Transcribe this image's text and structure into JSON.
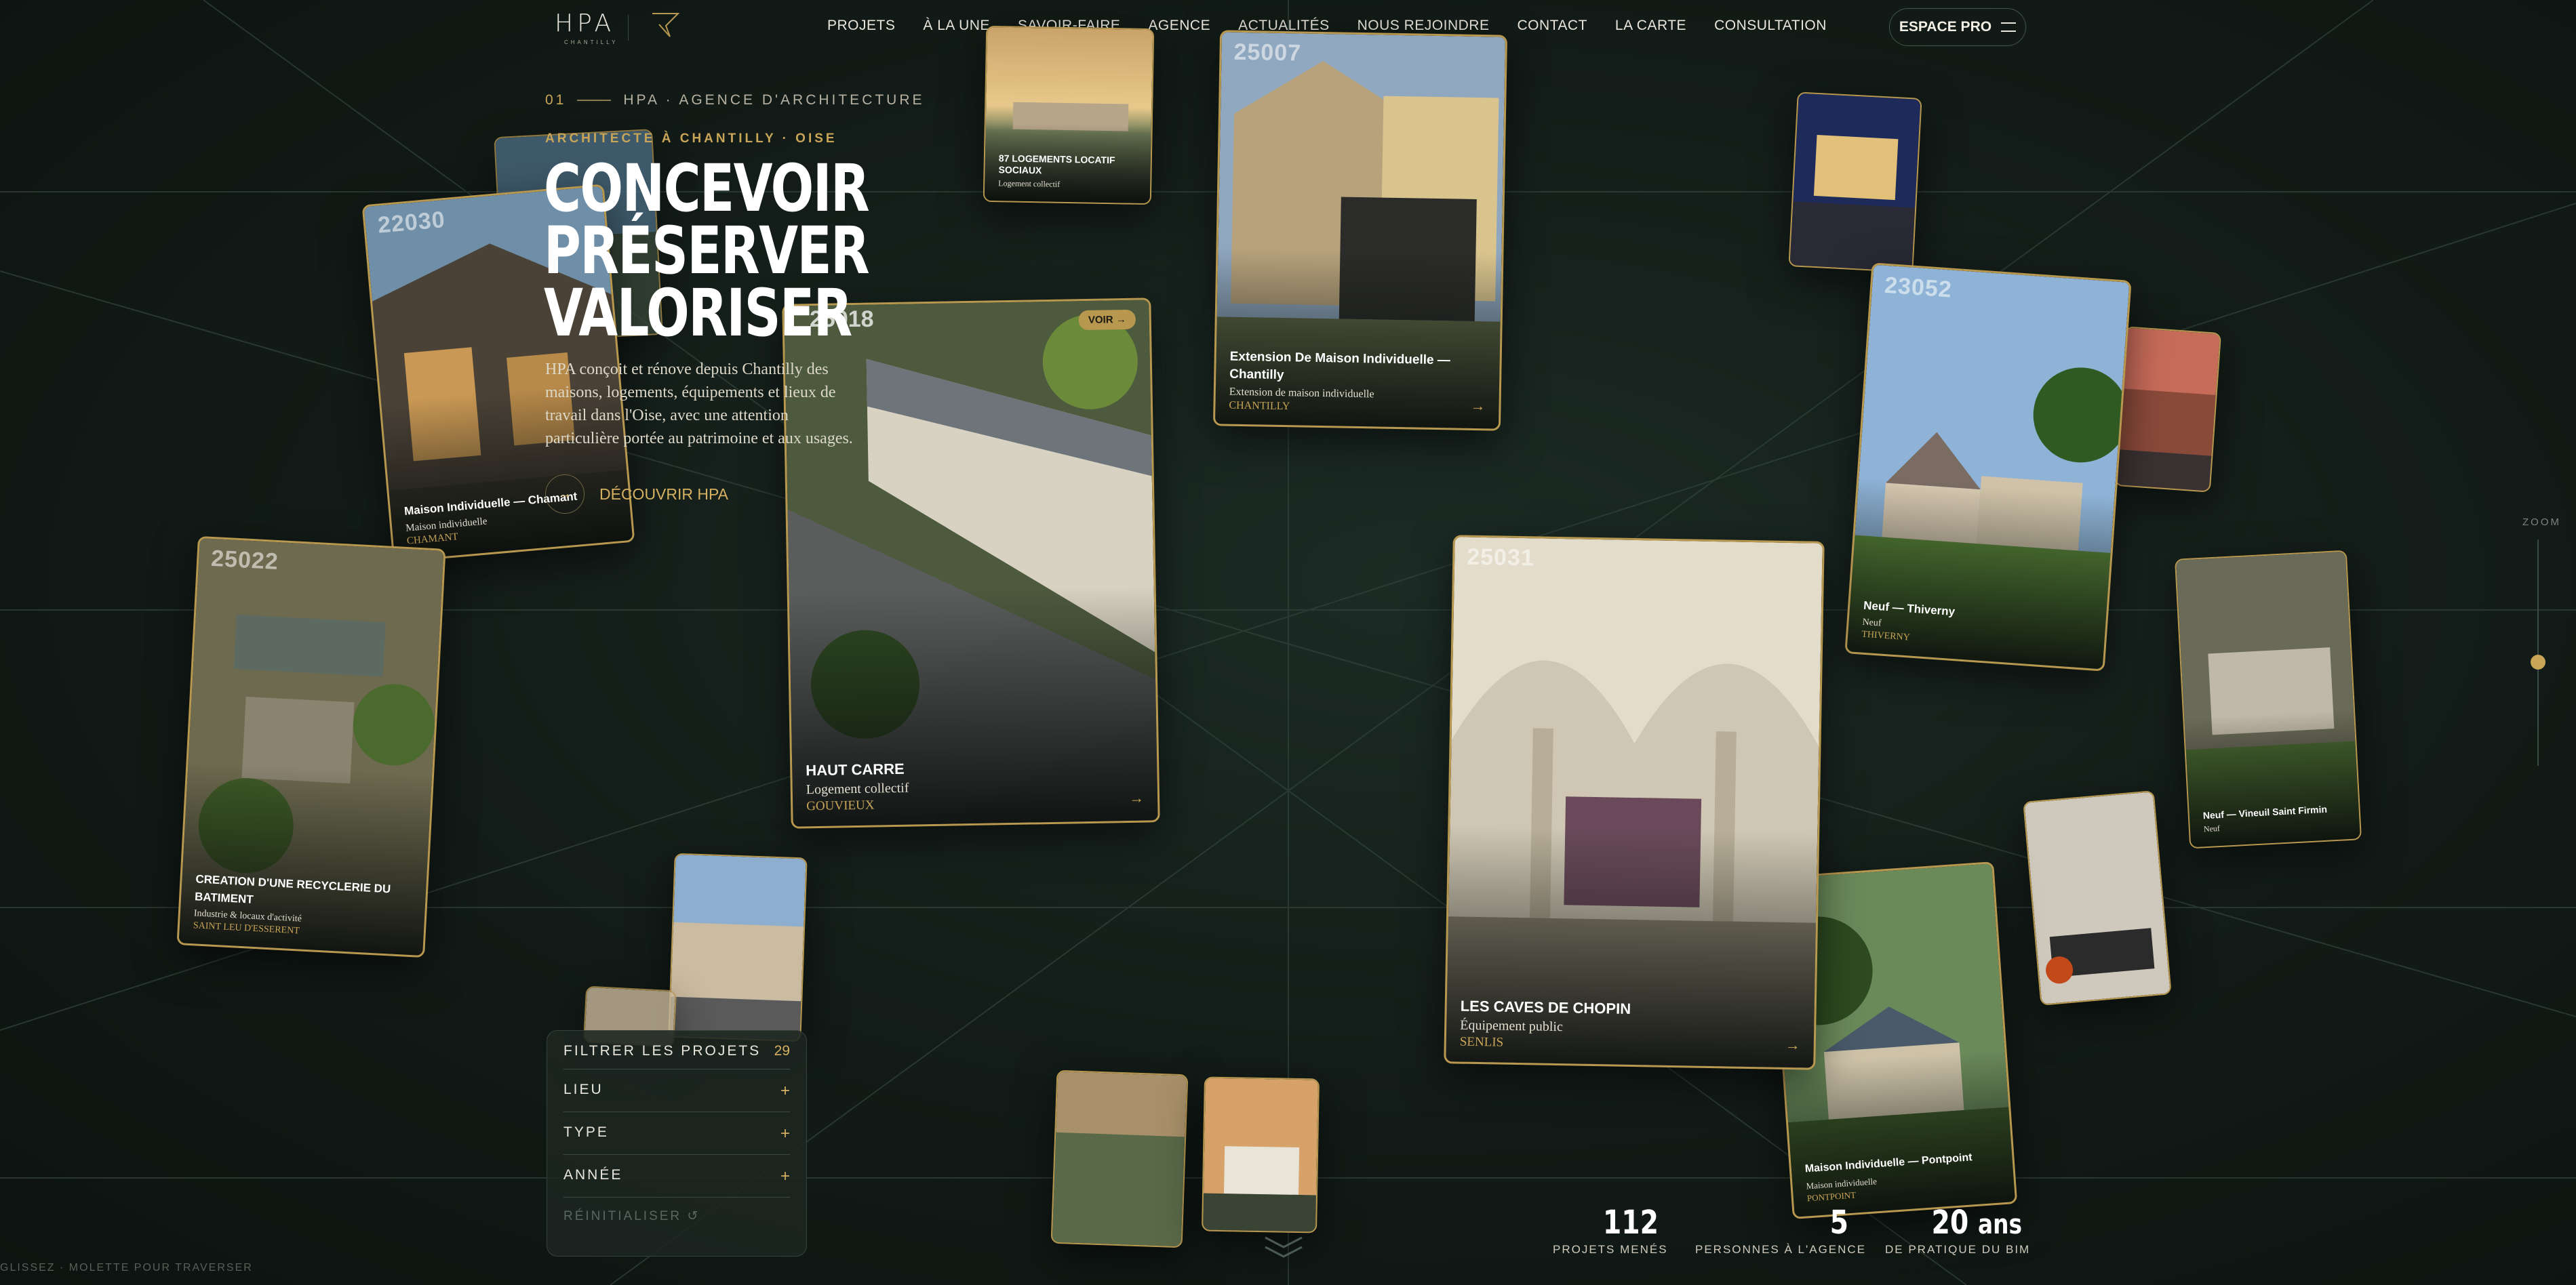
{
  "header": {
    "logo": "HPA",
    "logo_sub": "CHANTILLY",
    "nav": [
      "PROJETS",
      "À LA UNE",
      "SAVOIR-FAIRE",
      "AGENCE",
      "ACTUALITÉS",
      "NOUS REJOINDRE",
      "CONTACT",
      "LA CARTE",
      "CONSULTATION"
    ],
    "pro_button": "ESPACE PRO"
  },
  "hero": {
    "index": "01",
    "eyebrow": "HPA · AGENCE D'ARCHITECTURE",
    "kicker": "ARCHITECTE À CHANTILLY · OISE",
    "title_lines": [
      "CONCEVOIR",
      "PRÉSERVER",
      "VALORISER"
    ],
    "description": "HPA conçoit et rénove depuis Chantilly des maisons, logements, équipements et lieux de travail dans l'Oise, avec une attention particulière portée au patrimoine et aux usages.",
    "cta": "DÉCOUVRIR HPA"
  },
  "cards": {
    "haut_carre": {
      "code": "25018",
      "badge": "VOIR →",
      "title": "HAUT CARRE",
      "type": "Logement collectif",
      "city": "GOUVIEUX"
    },
    "caves": {
      "code": "25031",
      "title": "LES CAVES DE CHOPIN",
      "type": "Équipement public",
      "city": "SENLIS"
    },
    "extension": {
      "code": "25007",
      "title": "Extension De Maison Individuelle — Chantilly",
      "type": "Extension de maison individuelle",
      "city": "CHANTILLY"
    },
    "chamant": {
      "code": "22030",
      "title": "Maison Individuelle — Chamant",
      "type": "Maison individuelle",
      "city": "CHAMANT"
    },
    "recyclerie": {
      "code": "25022",
      "title": "CREATION D'UNE RECYCLERIE DU BATIMENT",
      "type": "Industrie & locaux d'activité",
      "city": "SAINT LEU D'ESSERENT"
    },
    "thiverny": {
      "code": "23052",
      "title": "Neuf — Thiverny",
      "type": "Neuf",
      "city": "THIVERNY"
    },
    "pontpoint": {
      "title": "Maison Individuelle — Pontpoint",
      "type": "Maison individuelle",
      "city": "PONTPOINT"
    },
    "logements_sociaux": {
      "title": "87 LOGEMENTS LOCATIF SOCIAUX",
      "type": "Logement collectif",
      "city": ""
    },
    "saint_firmin": {
      "title": "Neuf — Vineuil Saint Firmin",
      "type": "Neuf",
      "city": ""
    }
  },
  "filter": {
    "heading": "FILTRER LES PROJETS",
    "count": "29",
    "rows": [
      "LIEU",
      "TYPE",
      "ANNÉE"
    ],
    "plus": "+",
    "reset": "RÉINITIALISER ↺"
  },
  "stats": [
    {
      "value": "112",
      "unit": "",
      "label": "PROJETS MENÉS"
    },
    {
      "value": "5",
      "unit": "",
      "label": "PERSONNES À L'AGENCE"
    },
    {
      "value": "20",
      "unit": "ans",
      "label": "DE PRATIQUE DU BIM"
    }
  ],
  "zoom": {
    "label": "ZOOM"
  },
  "hint": "GLISSEZ · MOLETTE POUR TRAVERSER",
  "colors": {
    "gold": "#c9a558",
    "background": "#121b17"
  }
}
